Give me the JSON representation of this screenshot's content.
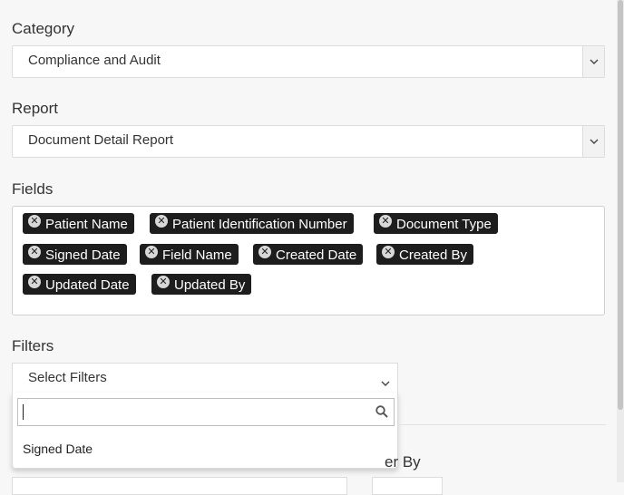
{
  "category": {
    "label": "Category",
    "value": "Compliance and Audit"
  },
  "report": {
    "label": "Report",
    "value": "Document Detail Report"
  },
  "fields": {
    "label": "Fields",
    "tags": [
      "Patient Name",
      "Patient Identification Number",
      "Document Type",
      "Signed Date",
      "Field Name",
      "Created Date",
      "Created By",
      "Updated Date",
      "Updated By"
    ]
  },
  "filters": {
    "label": "Filters",
    "placeholder": "Select Filters",
    "search_value": "",
    "options": [
      "Signed Date"
    ]
  },
  "order_by": {
    "label_partial": "er By"
  },
  "icons": {
    "dropdown_arrow": "chevron-down-icon",
    "tag_remove": "close-circle-icon",
    "search": "search-icon"
  },
  "colors": {
    "tag_bg": "#1d1d1d",
    "tag_text": "#ffffff",
    "page_bg": "#f7f7f7"
  }
}
